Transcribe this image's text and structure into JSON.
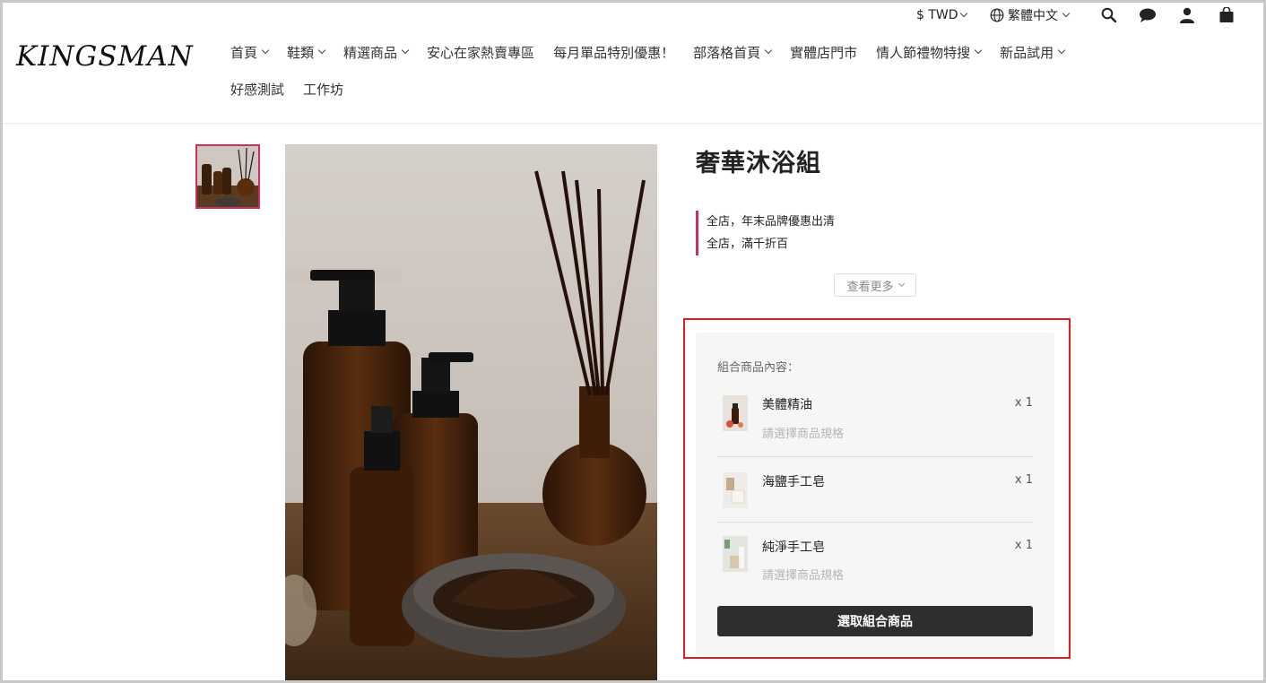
{
  "header": {
    "logo": "KINGSMAN",
    "currency": "$ TWD",
    "language": "繁體中文",
    "icons": [
      "globe-icon",
      "search-icon",
      "chat-icon",
      "user-icon",
      "cart-icon"
    ]
  },
  "nav": {
    "row1": [
      {
        "label": "首頁",
        "dropdown": true
      },
      {
        "label": "鞋類",
        "dropdown": true
      },
      {
        "label": "精選商品",
        "dropdown": true
      },
      {
        "label": "安心在家熱賣專區",
        "dropdown": false
      },
      {
        "label": "每月單品特別優惠！",
        "dropdown": false
      },
      {
        "label": "部落格首頁",
        "dropdown": true
      },
      {
        "label": "實體店門市",
        "dropdown": false
      },
      {
        "label": "情人節禮物特搜",
        "dropdown": true
      },
      {
        "label": "新品試用",
        "dropdown": true
      }
    ],
    "row2": [
      {
        "label": "好感測試",
        "dropdown": false
      },
      {
        "label": "工作坊",
        "dropdown": false
      }
    ]
  },
  "product": {
    "title": "奢華沐浴組",
    "promotions": [
      "全店，年末品牌優惠出清",
      "全店，滿千折百"
    ],
    "see_more": "查看更多"
  },
  "bundle": {
    "label": "組合商品內容：",
    "items": [
      {
        "name": "美體精油",
        "qty": "x 1",
        "spec": "請選擇商品規格"
      },
      {
        "name": "海鹽手工皂",
        "qty": "x 1",
        "spec": ""
      },
      {
        "name": "純淨手工皂",
        "qty": "x 1",
        "spec": "請選擇商品規格"
      }
    ],
    "button": "選取組合商品"
  },
  "colors": {
    "accent": "#c8315a",
    "highlight_outline": "#e31b1b",
    "button_bg": "#2e2e2e",
    "panel_bg": "#f6f6f6"
  }
}
